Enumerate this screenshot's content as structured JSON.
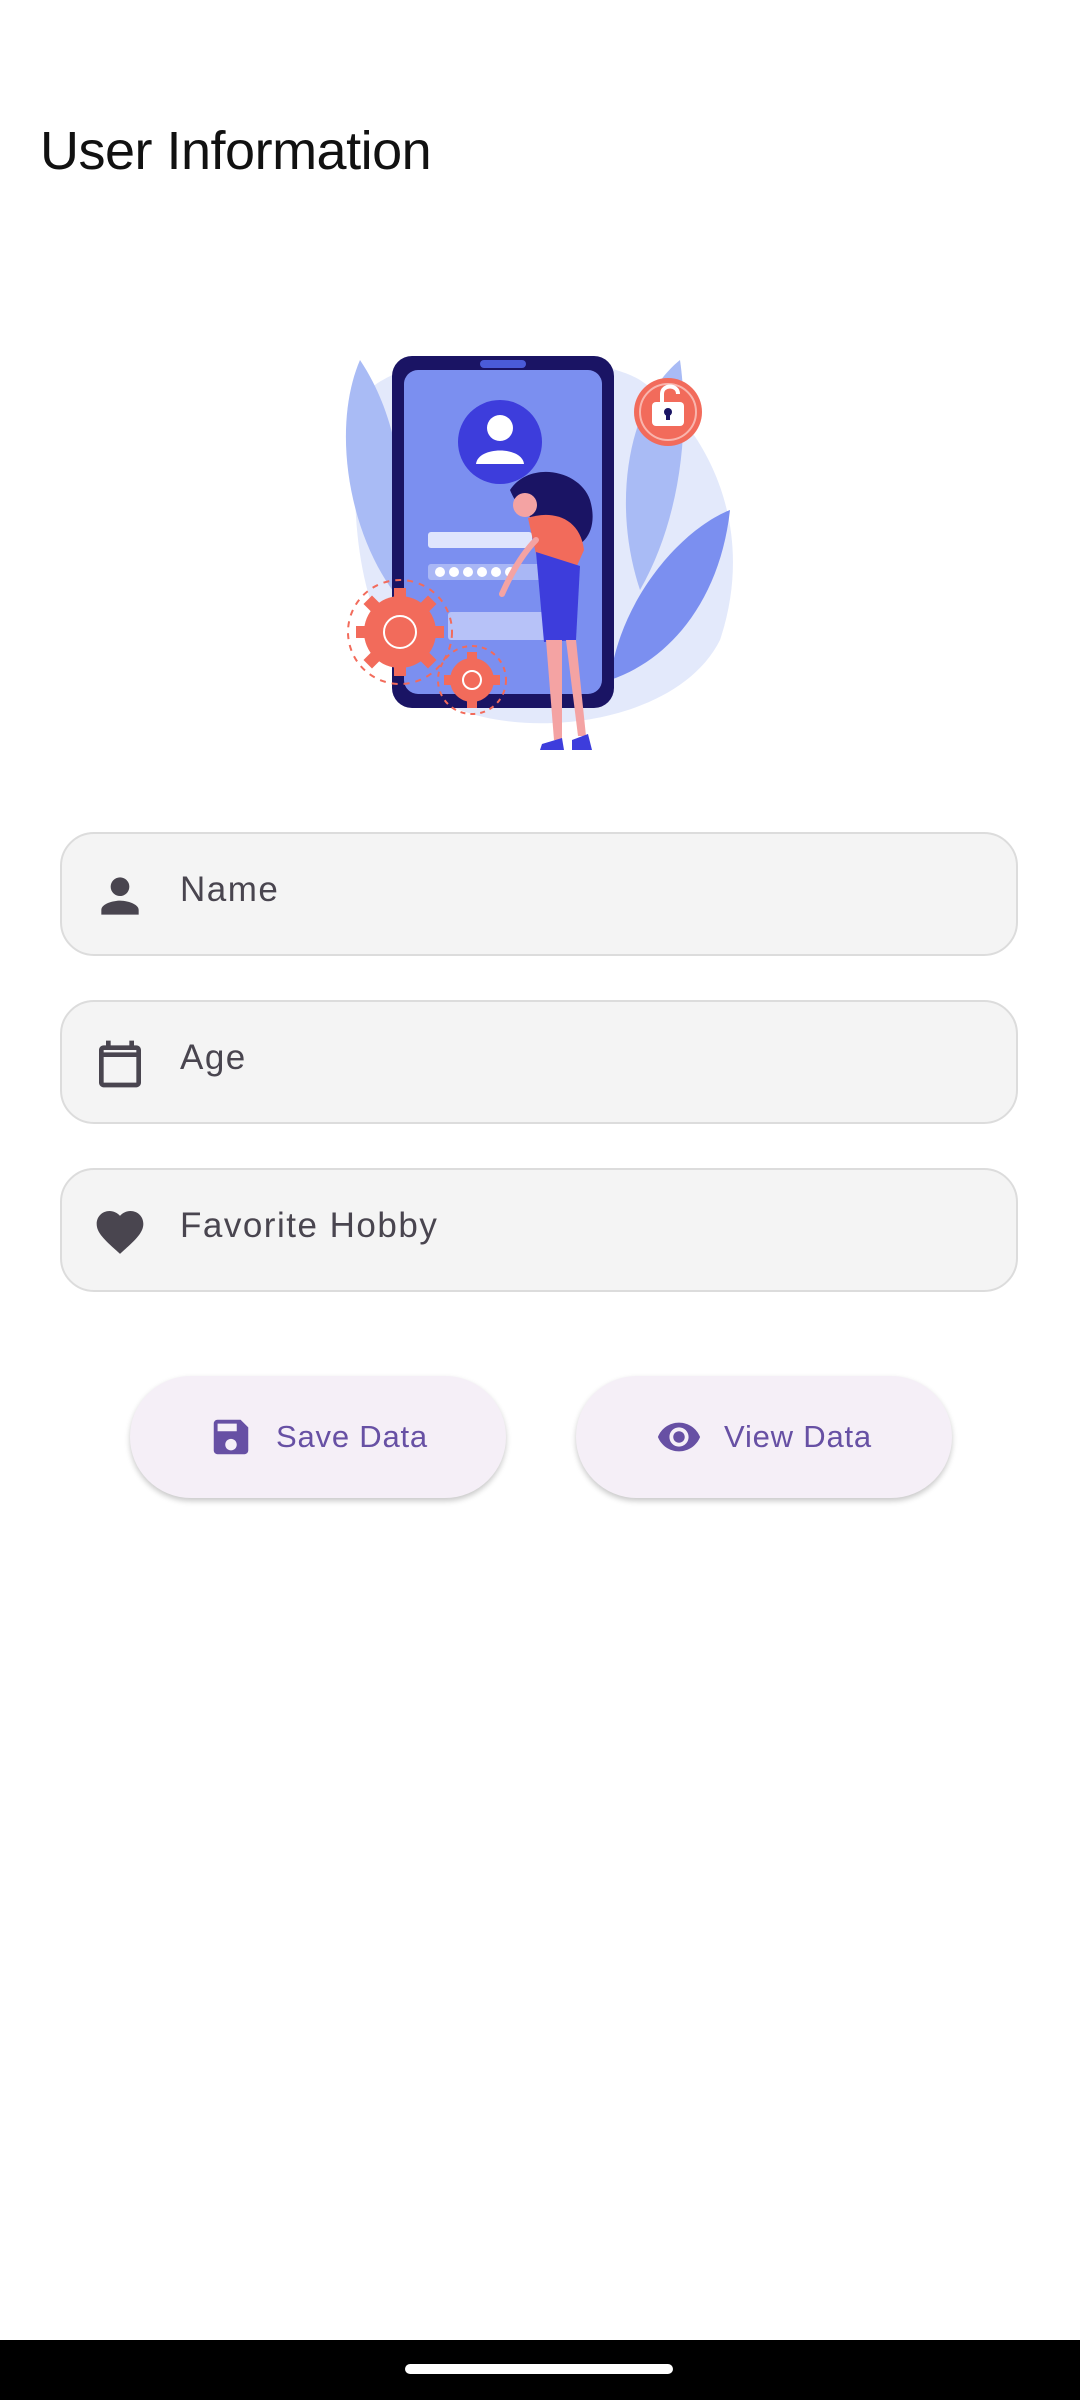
{
  "header": {
    "title": "User Information"
  },
  "form": {
    "name": {
      "placeholder": "Name",
      "value": "",
      "icon": "person-icon"
    },
    "age": {
      "placeholder": "Age",
      "value": "",
      "icon": "calendar-icon"
    },
    "hobby": {
      "placeholder": "Favorite Hobby",
      "value": "",
      "icon": "heart-icon"
    }
  },
  "actions": {
    "save_label": "Save Data",
    "save_icon": "save-icon",
    "view_label": "View Data",
    "view_icon": "eye-icon"
  },
  "colors": {
    "accent": "#6750a4",
    "field_bg": "#f4f4f4",
    "button_bg": "#f5eff7",
    "illustration_primary": "#7b8ff0",
    "illustration_dark": "#1a1464",
    "illustration_coral": "#f26b5b"
  }
}
